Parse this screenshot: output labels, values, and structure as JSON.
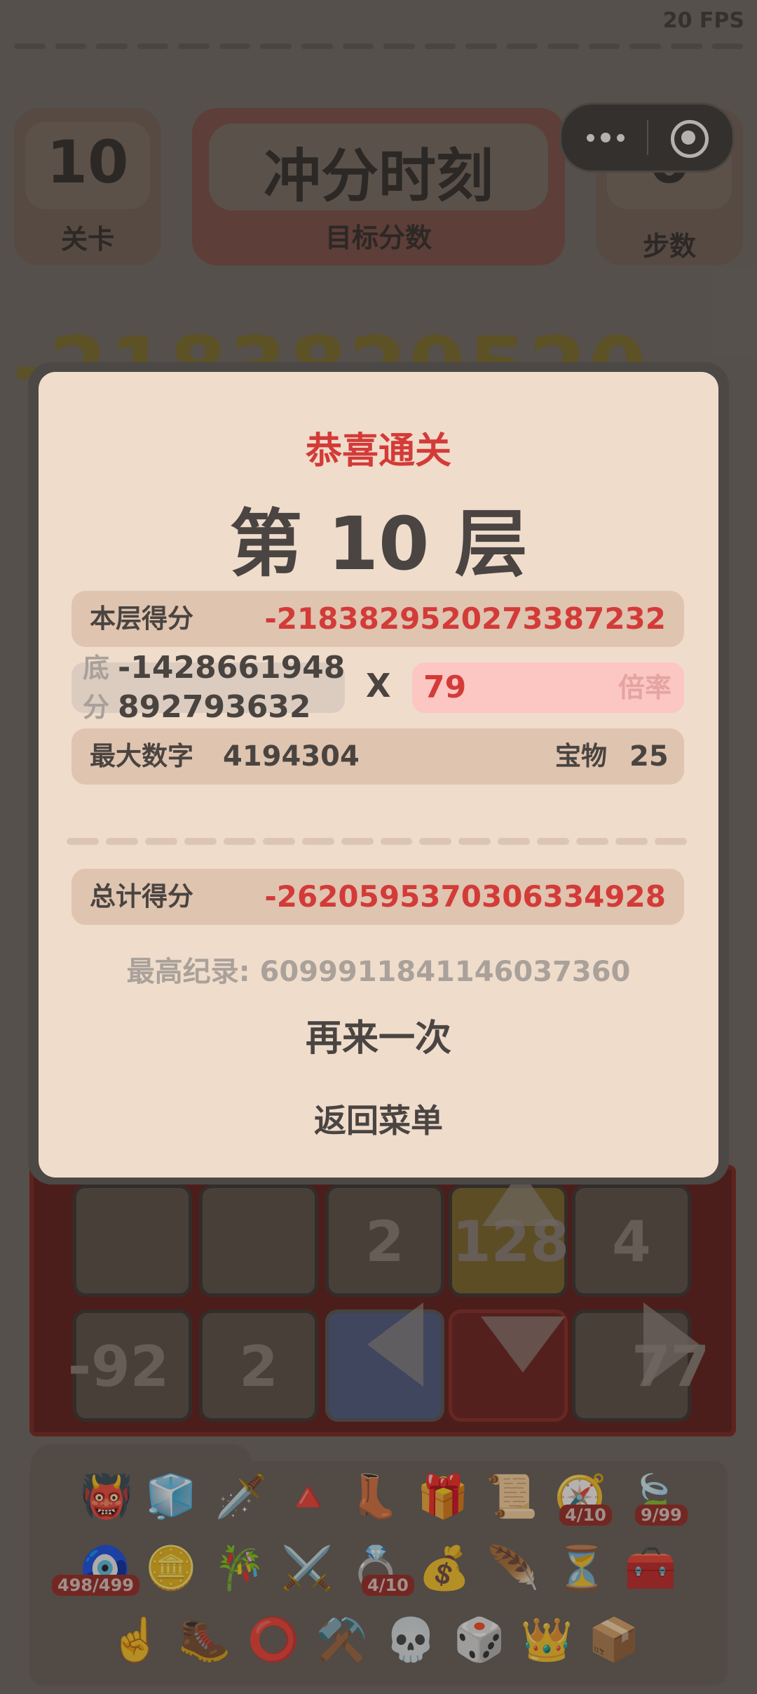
{
  "hud": {
    "fps": "20 FPS",
    "level_value": "10",
    "level_label": "关卡",
    "target_value": "冲分时刻",
    "target_label": "目标分数",
    "steps_value": "0",
    "steps_label": "步数",
    "bg_score_partial": "-2183829520"
  },
  "board": {
    "row1": [
      "",
      "",
      "2",
      "128",
      "4"
    ],
    "row2": [
      "-92",
      "2",
      "",
      "",
      "77"
    ]
  },
  "items": {
    "badges": [
      "4/10",
      "9/99",
      "498/499",
      "4/10"
    ],
    "icons": [
      "demon-skull-icon",
      "ice-cube-icon",
      "sword-icon",
      "pyramid-eye-icon",
      "red-boot-icon",
      "purple-chest-icon",
      "map-scroll-icon",
      "compass-icon",
      "leaf-icon",
      "eye-amulet-icon",
      "gold-coin-icon",
      "flute-icon",
      "sword-coin-icon",
      "gold-ring-icon",
      "money-bag-icon",
      "feather-icon",
      "hourglass-icon",
      "treasure-chest-icon",
      "pointing-hand-icon",
      "iron-boot-icon",
      "bronze-ring-icon",
      "anvil-icon",
      "skull-shield-icon",
      "d12-dice-icon",
      "crown-icon",
      "wood-crate-icon"
    ]
  },
  "modal": {
    "title": "恭喜通关",
    "floor": "第 10 层",
    "floor_score_label": "本层得分",
    "floor_score_value": "-2183829520273387232",
    "base_label_1": "底",
    "base_label_2": "分",
    "base_value_1": "-1428661948",
    "base_value_2": "892793632",
    "times": "X",
    "multiplier_value": "79",
    "multiplier_label": "倍率",
    "max_number_label": "最大数字",
    "max_number_value": "4194304",
    "treasure_label": "宝物",
    "treasure_value": "25",
    "total_label": "总计得分",
    "total_value": "-2620595370306334928",
    "best_record": "最高纪录: 6099911841146037360",
    "retry": "再来一次",
    "back_to_menu": "返回菜单"
  }
}
